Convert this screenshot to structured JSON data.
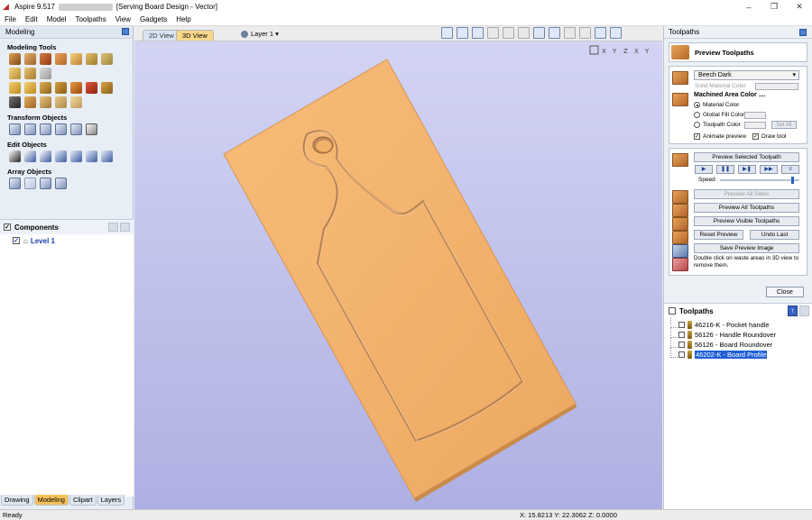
{
  "window": {
    "app_title": "Aspire 9.517",
    "doc_title": "[Serving Board Design - Vector]",
    "controls": [
      "–",
      "❐",
      "✕"
    ]
  },
  "menu": [
    "File",
    "Edit",
    "Model",
    "Toolpaths",
    "View",
    "Gadgets",
    "Help"
  ],
  "left_panel": {
    "title": "Modeling",
    "sections": {
      "modeling_tools": "Modeling Tools",
      "transform_objects": "Transform Objects",
      "edit_objects": "Edit Objects",
      "array_objects": "Array Objects"
    },
    "components": {
      "title": "Components",
      "level": "Level 1"
    },
    "tabs": [
      "Drawing",
      "Modeling",
      "Clipart",
      "Layers"
    ],
    "active_tab": "Modeling"
  },
  "view_bar": {
    "tab_2d": "2D View",
    "tab_3d": "3D View",
    "layer": "Layer 1 ▾"
  },
  "right_panel": {
    "title": "Toolpaths",
    "preview_title": "Preview Toolpaths",
    "material": "Beech Dark",
    "solid_material_color": "Solid Material Color",
    "machined_area_title": "Machined Area Color ....",
    "radio_material": "Material Color",
    "radio_global": "Global Fill Color",
    "radio_toolpath": "Toolpath Color",
    "set_all": "Set All",
    "animate_preview": "Animate preview",
    "draw_tool": "Draw tool",
    "preview_selected": "Preview Selected Toolpath",
    "speed": "Speed",
    "speed_level": 0.9,
    "preview_all_sides": "Preview All Sides",
    "preview_all": "Preview All Toolpaths",
    "preview_visible": "Preview Visible Toolpaths",
    "reset_preview": "Reset Preview",
    "undo_last": "Undo Last",
    "save_preview": "Save Preview Image",
    "hint": "Double click on waste areas in 3D view to remove them.",
    "close": "Close"
  },
  "toolpaths": {
    "title": "Toolpaths",
    "items": [
      {
        "name": "46216-K - Pocket handle",
        "checked": false,
        "selected": false
      },
      {
        "name": "56126 - Handle Roundover",
        "checked": false,
        "selected": false
      },
      {
        "name": "56126 - Board Roundover",
        "checked": false,
        "selected": false
      },
      {
        "name": "46202-K - Board Profile",
        "checked": false,
        "selected": true
      }
    ]
  },
  "status": {
    "state": "Ready",
    "coords": "X: 15.8213 Y: 22.3062 Z:  0.0000"
  },
  "colors": {
    "wood": "#f3b26a",
    "viewport_top": "#cfd0f2",
    "viewport_bottom": "#aeb0e2",
    "selection": "#1f5fd6"
  }
}
